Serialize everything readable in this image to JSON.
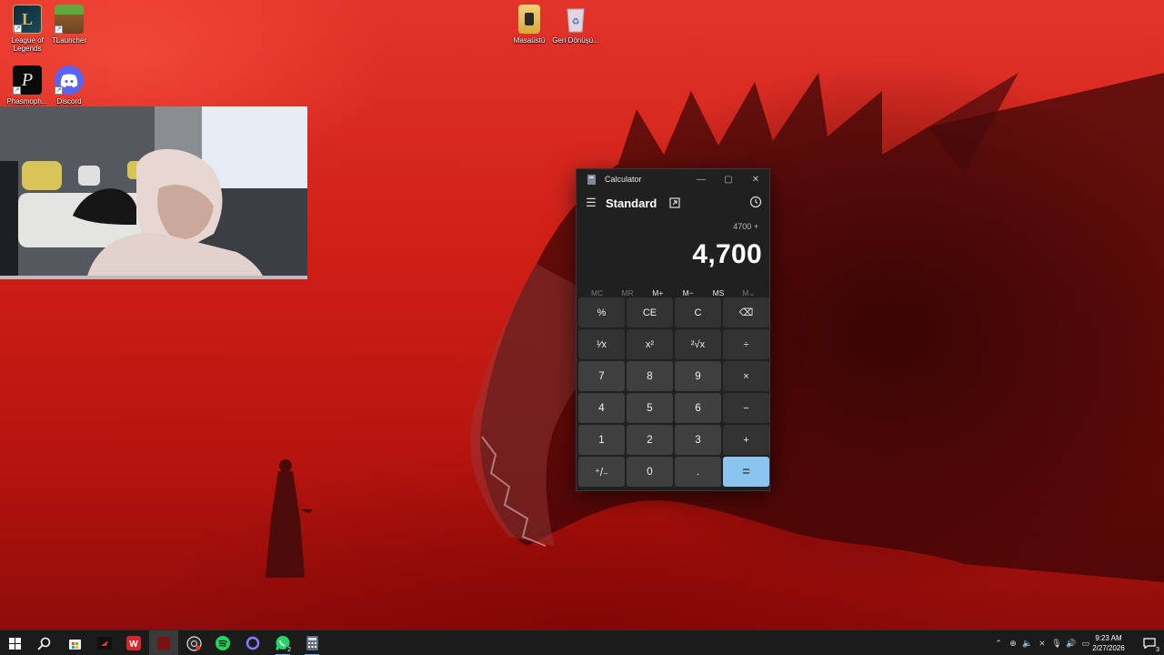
{
  "desktop": {
    "icons": [
      {
        "label": "League of Legends",
        "icon": "league-of-legends-icon"
      },
      {
        "label": "TLauncher",
        "icon": "tlauncher-icon"
      },
      {
        "label": "Phasmoph...",
        "icon": "phasmophobia-icon"
      },
      {
        "label": "Discord",
        "icon": "discord-icon"
      },
      {
        "label": "Masaüstü",
        "icon": "folder-icon"
      },
      {
        "label": "Geri Dönüşü...",
        "icon": "recycle-bin-icon"
      }
    ]
  },
  "calculator": {
    "title": "Calculator",
    "mode": "Standard",
    "expression": "4700 +",
    "display": "4,700",
    "memory": [
      {
        "label": "MC",
        "enabled": false
      },
      {
        "label": "MR",
        "enabled": false
      },
      {
        "label": "M+",
        "enabled": true
      },
      {
        "label": "M−",
        "enabled": true
      },
      {
        "label": "MS",
        "enabled": true
      },
      {
        "label": "M⌄",
        "enabled": false
      }
    ],
    "keys": [
      {
        "label": "%",
        "type": "fn",
        "name": "percent-key"
      },
      {
        "label": "CE",
        "type": "fn",
        "name": "clear-entry-key"
      },
      {
        "label": "C",
        "type": "fn",
        "name": "clear-key"
      },
      {
        "label": "⌫",
        "type": "fn",
        "name": "backspace-key"
      },
      {
        "label": "¹⁄x",
        "type": "fn",
        "name": "reciprocal-key"
      },
      {
        "label": "x²",
        "type": "fn",
        "name": "square-key"
      },
      {
        "label": "²√x",
        "type": "fn",
        "name": "square-root-key"
      },
      {
        "label": "÷",
        "type": "fn",
        "name": "divide-key"
      },
      {
        "label": "7",
        "type": "num",
        "name": "digit-7-key"
      },
      {
        "label": "8",
        "type": "num",
        "name": "digit-8-key"
      },
      {
        "label": "9",
        "type": "num",
        "name": "digit-9-key"
      },
      {
        "label": "×",
        "type": "fn",
        "name": "multiply-key"
      },
      {
        "label": "4",
        "type": "num",
        "name": "digit-4-key"
      },
      {
        "label": "5",
        "type": "num",
        "name": "digit-5-key"
      },
      {
        "label": "6",
        "type": "num",
        "name": "digit-6-key"
      },
      {
        "label": "−",
        "type": "fn",
        "name": "subtract-key"
      },
      {
        "label": "1",
        "type": "num",
        "name": "digit-1-key"
      },
      {
        "label": "2",
        "type": "num",
        "name": "digit-2-key"
      },
      {
        "label": "3",
        "type": "num",
        "name": "digit-3-key"
      },
      {
        "label": "+",
        "type": "fn",
        "name": "add-key"
      },
      {
        "label": "⁺/₋",
        "type": "num",
        "name": "negate-key"
      },
      {
        "label": "0",
        "type": "num",
        "name": "digit-0-key"
      },
      {
        "label": ".",
        "type": "num",
        "name": "decimal-key"
      },
      {
        "label": "=",
        "type": "eq",
        "name": "equals-key"
      }
    ]
  },
  "taskbar": {
    "apps": [
      "start-icon",
      "search-icon",
      "store-icon",
      "game-app-icon",
      "wps-office-icon",
      "active-app-icon",
      "obs-icon",
      "spotify-icon",
      "cortana-icon",
      "whatsapp-icon",
      "calculator-icon"
    ],
    "whatsapp_badge": "2",
    "notification_count": "3",
    "time": "9:23 AM",
    "date": "2/27/2026"
  },
  "colors": {
    "accent": "#8cc4f0",
    "calc_bg": "#202020",
    "taskbar_bg": "#1b1b1c"
  }
}
